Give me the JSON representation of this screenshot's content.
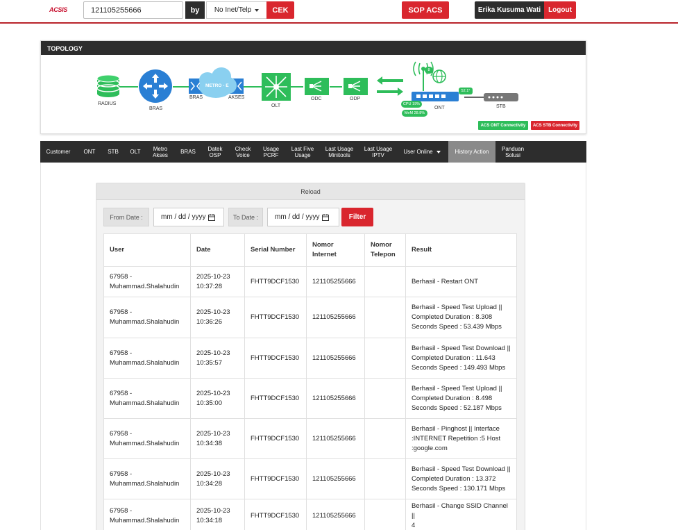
{
  "header": {
    "logo": "ACSIS",
    "search_value": "121105255666",
    "by_label": "by",
    "search_type": "No Inet/Telp",
    "cek_label": "CEK",
    "sop_label": "SOP ACS",
    "user_name": "Erika Kusuma Wati",
    "logout_label": "Logout"
  },
  "topology": {
    "title": "TOPOLOGY",
    "nodes": {
      "radius": "RADIUS",
      "bras": "BRAS",
      "metro_cloud": "METRO - E",
      "bras_port": "BRAS",
      "akses": "AKSES",
      "olt": "OLT",
      "odc": "ODC",
      "odp": "ODP",
      "ont": "ONT",
      "stb": "STB"
    },
    "ont_status": {
      "temp": "52.1°",
      "cpu": "CPU 19%",
      "mem": "MeM 28.8%",
      "signal": "8"
    },
    "acs_ont_label": "ACS ONT Connectivity",
    "acs_stb_label": "ACS STB Connectivity",
    "colors": {
      "green": "#2ebd5a",
      "blue": "#2a7fd4",
      "red": "#d9262e"
    }
  },
  "nav": {
    "items": [
      {
        "label": "Customer"
      },
      {
        "label": "ONT"
      },
      {
        "label": "STB"
      },
      {
        "label": "OLT"
      },
      {
        "label": "Metro\nAkses"
      },
      {
        "label": "BRAS"
      },
      {
        "label": "Datek\nOSP"
      },
      {
        "label": "Check\nVoice"
      },
      {
        "label": "Usage\nPCRF"
      },
      {
        "label": "Last Five\nUsage"
      },
      {
        "label": "Last Usage\nMinitools"
      },
      {
        "label": "Last Usage\nIPTV"
      },
      {
        "label": "User Online"
      },
      {
        "label": "History Action"
      },
      {
        "label": "Panduan\nSolusi"
      }
    ],
    "active": "History Action"
  },
  "history": {
    "reload_label": "Reload",
    "from_label": "From Date :",
    "to_label": "To Date :",
    "date_placeholder": "mm / dd / yyyy",
    "filter_label": "Filter",
    "columns": [
      "User",
      "Date",
      "Serial Number",
      "Nomor\nInternet",
      "Nomor\nTelepon",
      "Result"
    ],
    "rows": [
      {
        "user": "67958 -\nMuhammad.Shalahudin",
        "date": "2025-10-23\n10:37:28",
        "serial": "FHTT9DCF1530",
        "internet": "121105255666",
        "telepon": "",
        "result": "Berhasil - Restart ONT"
      },
      {
        "user": "67958 -\nMuhammad.Shalahudin",
        "date": "2025-10-23\n10:36:26",
        "serial": "FHTT9DCF1530",
        "internet": "121105255666",
        "telepon": "",
        "result": "Berhasil - Speed Test Upload ||\nCompleted Duration : 8.308\nSeconds Speed : 53.439 Mbps"
      },
      {
        "user": "67958 -\nMuhammad.Shalahudin",
        "date": "2025-10-23\n10:35:57",
        "serial": "FHTT9DCF1530",
        "internet": "121105255666",
        "telepon": "",
        "result": "Berhasil - Speed Test Download ||\nCompleted Duration : 11.643\nSeconds Speed : 149.493 Mbps"
      },
      {
        "user": "67958 -\nMuhammad.Shalahudin",
        "date": "2025-10-23\n10:35:00",
        "serial": "FHTT9DCF1530",
        "internet": "121105255666",
        "telepon": "",
        "result": "Berhasil - Speed Test Upload ||\nCompleted Duration : 8.498\nSeconds Speed : 52.187 Mbps"
      },
      {
        "user": "67958 -\nMuhammad.Shalahudin",
        "date": "2025-10-23\n10:34:38",
        "serial": "FHTT9DCF1530",
        "internet": "121105255666",
        "telepon": "",
        "result": "Berhasil - Pinghost || Interface\n:INTERNET Repetition :5 Host\n:google.com"
      },
      {
        "user": "67958 -\nMuhammad.Shalahudin",
        "date": "2025-10-23\n10:34:28",
        "serial": "FHTT9DCF1530",
        "internet": "121105255666",
        "telepon": "",
        "result": "Berhasil - Speed Test Download ||\nCompleted Duration : 13.372\nSeconds Speed : 130.171 Mbps"
      },
      {
        "user": "67958 -\nMuhammad.Shalahudin",
        "date": "2025-10-23\n10:34:18",
        "serial": "FHTT9DCF1530",
        "internet": "121105255666",
        "telepon": "",
        "result": "Berhasil - Change SSID Channel ||\n4"
      }
    ]
  }
}
